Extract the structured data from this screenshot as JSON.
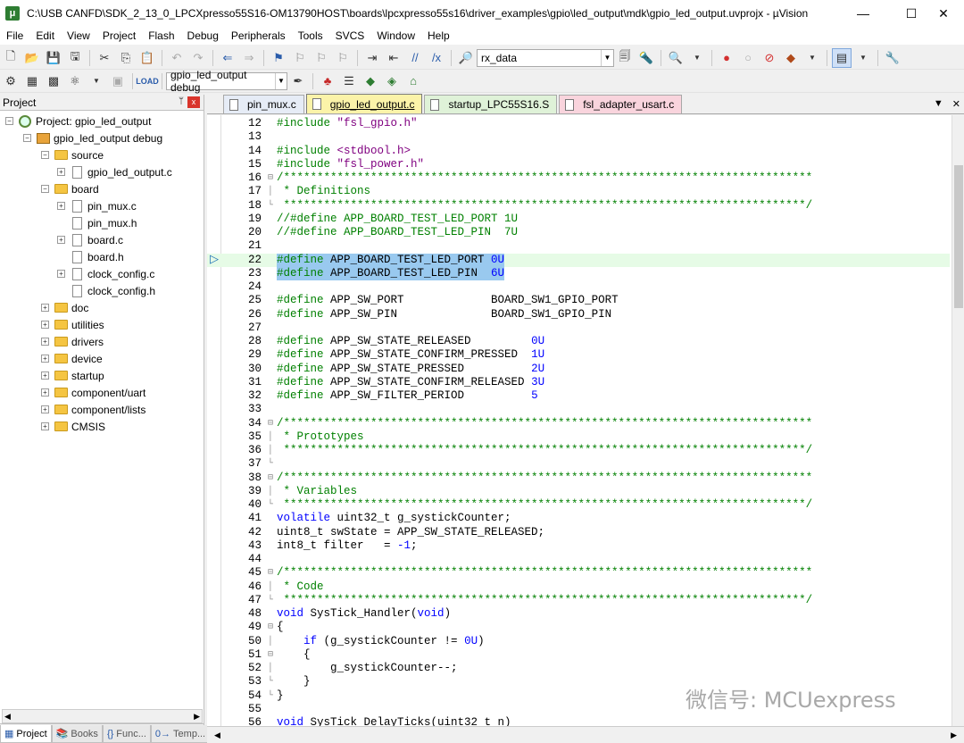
{
  "window": {
    "title": "C:\\USB CANFD\\SDK_2_13_0_LPCXpresso55S16-OM13790HOST\\boards\\lpcxpresso55s16\\driver_examples\\gpio\\led_output\\mdk\\gpio_led_output.uvprojx - µVision",
    "app_icon": "uvision-icon",
    "minimize": "—",
    "maximize": "☐",
    "close": "✕"
  },
  "menu": [
    "File",
    "Edit",
    "View",
    "Project",
    "Flash",
    "Debug",
    "Peripherals",
    "Tools",
    "SVCS",
    "Window",
    "Help"
  ],
  "toolbar1": {
    "find_value": "rx_data"
  },
  "toolbar2": {
    "target_value": "gpio_led_output debug"
  },
  "project_panel": {
    "title": "Project",
    "pin": "ᛘ",
    "close": "x",
    "tree": [
      {
        "label": "Project: gpio_led_output",
        "level": 0,
        "toggle": "⊟",
        "icon": "proj"
      },
      {
        "label": "gpio_led_output debug",
        "level": 1,
        "toggle": "⊟",
        "icon": "target"
      },
      {
        "label": "source",
        "level": 2,
        "toggle": "⊟",
        "icon": "folder"
      },
      {
        "label": "gpio_led_output.c",
        "level": 3,
        "toggle": "⊞",
        "icon": "file"
      },
      {
        "label": "board",
        "level": 2,
        "toggle": "⊟",
        "icon": "folder"
      },
      {
        "label": "pin_mux.c",
        "level": 3,
        "toggle": "⊞",
        "icon": "file"
      },
      {
        "label": "pin_mux.h",
        "level": 3,
        "toggle": "",
        "icon": "file"
      },
      {
        "label": "board.c",
        "level": 3,
        "toggle": "⊞",
        "icon": "file"
      },
      {
        "label": "board.h",
        "level": 3,
        "toggle": "",
        "icon": "file"
      },
      {
        "label": "clock_config.c",
        "level": 3,
        "toggle": "⊞",
        "icon": "file"
      },
      {
        "label": "clock_config.h",
        "level": 3,
        "toggle": "",
        "icon": "file"
      },
      {
        "label": "doc",
        "level": 2,
        "toggle": "⊞",
        "icon": "folder"
      },
      {
        "label": "utilities",
        "level": 2,
        "toggle": "⊞",
        "icon": "folder"
      },
      {
        "label": "drivers",
        "level": 2,
        "toggle": "⊞",
        "icon": "folder"
      },
      {
        "label": "device",
        "level": 2,
        "toggle": "⊞",
        "icon": "folder"
      },
      {
        "label": "startup",
        "level": 2,
        "toggle": "⊞",
        "icon": "folder"
      },
      {
        "label": "component/uart",
        "level": 2,
        "toggle": "⊞",
        "icon": "folder"
      },
      {
        "label": "component/lists",
        "level": 2,
        "toggle": "⊞",
        "icon": "folder"
      },
      {
        "label": "CMSIS",
        "level": 2,
        "toggle": "⊞",
        "icon": "folder"
      }
    ],
    "bottom_tabs": [
      {
        "label": "Project",
        "icon": "▦",
        "active": true
      },
      {
        "label": "Books",
        "icon": "📚",
        "active": false
      },
      {
        "label": "Func...",
        "icon": "{}",
        "active": false
      },
      {
        "label": "Temp...",
        "icon": "0→",
        "active": false
      }
    ]
  },
  "editor_tabs": [
    {
      "label": "pin_mux.c",
      "bg": "#e6ecf6",
      "active": false,
      "underline": false
    },
    {
      "label": "gpio_led_output.c",
      "bg": "#fbf3a9",
      "active": true,
      "underline": true
    },
    {
      "label": "startup_LPC55S16.S",
      "bg": "#dff2d8",
      "active": false,
      "underline": false
    },
    {
      "label": "fsl_adapter_usart.c",
      "bg": "#f9d4dd",
      "active": false,
      "underline": false
    }
  ],
  "tab_end": {
    "dropdown": "▼",
    "close": "✕"
  },
  "watermark": "微信号: MCUexpress",
  "code": [
    {
      "n": "12",
      "f": "",
      "t": "#include \"fsl_gpio.h\"",
      "k": "inc"
    },
    {
      "n": "13",
      "f": "",
      "t": "",
      "k": ""
    },
    {
      "n": "14",
      "f": "",
      "t": "#include <stdbool.h>",
      "k": "inc"
    },
    {
      "n": "15",
      "f": "",
      "t": "#include \"fsl_power.h\"",
      "k": "inc"
    },
    {
      "n": "16",
      "f": "⊟",
      "t": "/*******************************************************************************",
      "k": "cm"
    },
    {
      "n": "17",
      "f": "│",
      "t": " * Definitions",
      "k": "cm"
    },
    {
      "n": "18",
      "f": "└",
      "t": " ******************************************************************************/",
      "k": "cm"
    },
    {
      "n": "19",
      "f": "",
      "t": "//#define APP_BOARD_TEST_LED_PORT 1U",
      "k": "cm"
    },
    {
      "n": "20",
      "f": "",
      "t": "//#define APP_BOARD_TEST_LED_PIN  7U",
      "k": "cm"
    },
    {
      "n": "21",
      "f": "",
      "t": "",
      "k": ""
    },
    {
      "n": "22",
      "f": "",
      "t": "#define APP_BOARD_TEST_LED_PORT 0U",
      "k": "sel",
      "cur": true
    },
    {
      "n": "23",
      "f": "",
      "t": "#define APP_BOARD_TEST_LED_PIN  6U",
      "k": "sel"
    },
    {
      "n": "24",
      "f": "",
      "t": "",
      "k": ""
    },
    {
      "n": "25",
      "f": "",
      "t": "#define APP_SW_PORT             BOARD_SW1_GPIO_PORT",
      "k": "def"
    },
    {
      "n": "26",
      "f": "",
      "t": "#define APP_SW_PIN              BOARD_SW1_GPIO_PIN",
      "k": "def"
    },
    {
      "n": "27",
      "f": "",
      "t": "",
      "k": ""
    },
    {
      "n": "28",
      "f": "",
      "t": "#define APP_SW_STATE_RELEASED         0U",
      "k": "def"
    },
    {
      "n": "29",
      "f": "",
      "t": "#define APP_SW_STATE_CONFIRM_PRESSED  1U",
      "k": "def"
    },
    {
      "n": "30",
      "f": "",
      "t": "#define APP_SW_STATE_PRESSED          2U",
      "k": "def"
    },
    {
      "n": "31",
      "f": "",
      "t": "#define APP_SW_STATE_CONFIRM_RELEASED 3U",
      "k": "def"
    },
    {
      "n": "32",
      "f": "",
      "t": "#define APP_SW_FILTER_PERIOD          5",
      "k": "def"
    },
    {
      "n": "33",
      "f": "",
      "t": "",
      "k": ""
    },
    {
      "n": "34",
      "f": "⊟",
      "t": "/*******************************************************************************",
      "k": "cm"
    },
    {
      "n": "35",
      "f": "│",
      "t": " * Prototypes",
      "k": "cm"
    },
    {
      "n": "36",
      "f": "│",
      "t": " ******************************************************************************/",
      "k": "cm"
    },
    {
      "n": "37",
      "f": "└",
      "t": "",
      "k": ""
    },
    {
      "n": "38",
      "f": "⊟",
      "t": "/*******************************************************************************",
      "k": "cm"
    },
    {
      "n": "39",
      "f": "│",
      "t": " * Variables",
      "k": "cm"
    },
    {
      "n": "40",
      "f": "└",
      "t": " ******************************************************************************/",
      "k": "cm"
    },
    {
      "n": "41",
      "f": "",
      "t": "volatile uint32_t g_systickCounter;",
      "k": "code"
    },
    {
      "n": "42",
      "f": "",
      "t": "uint8_t swState = APP_SW_STATE_RELEASED;",
      "k": "code"
    },
    {
      "n": "43",
      "f": "",
      "t": "int8_t filter   = -1;",
      "k": "code"
    },
    {
      "n": "44",
      "f": "",
      "t": "",
      "k": ""
    },
    {
      "n": "45",
      "f": "⊟",
      "t": "/*******************************************************************************",
      "k": "cm"
    },
    {
      "n": "46",
      "f": "│",
      "t": " * Code",
      "k": "cm"
    },
    {
      "n": "47",
      "f": "└",
      "t": " ******************************************************************************/",
      "k": "cm"
    },
    {
      "n": "48",
      "f": "",
      "t": "void SysTick_Handler(void)",
      "k": "code"
    },
    {
      "n": "49",
      "f": "⊟",
      "t": "{",
      "k": "code"
    },
    {
      "n": "50",
      "f": "│",
      "t": "    if (g_systickCounter != 0U)",
      "k": "code"
    },
    {
      "n": "51",
      "f": "⊟",
      "t": "    {",
      "k": "code"
    },
    {
      "n": "52",
      "f": "│",
      "t": "        g_systickCounter--;",
      "k": "code"
    },
    {
      "n": "53",
      "f": "└",
      "t": "    }",
      "k": "code"
    },
    {
      "n": "54",
      "f": "└",
      "t": "}",
      "k": "code"
    },
    {
      "n": "55",
      "f": "",
      "t": "",
      "k": ""
    },
    {
      "n": "56",
      "f": "",
      "t": "void SysTick_DelayTicks(uint32_t n)",
      "k": "code"
    }
  ]
}
